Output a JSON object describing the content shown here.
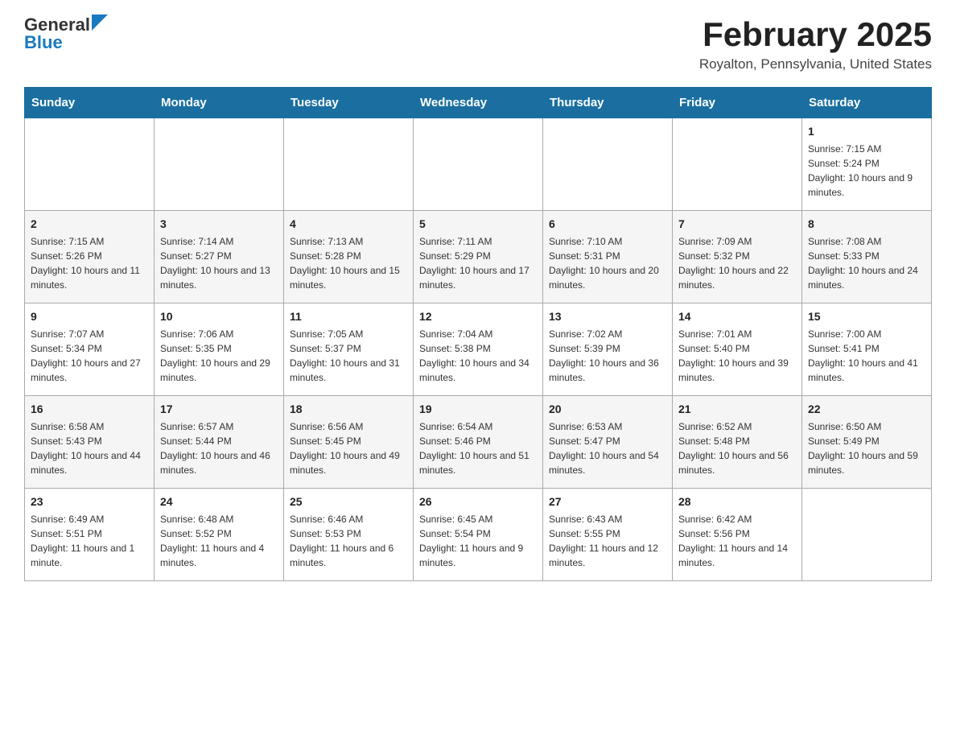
{
  "header": {
    "logo_general": "General",
    "logo_blue": "Blue",
    "month_title": "February 2025",
    "location": "Royalton, Pennsylvania, United States"
  },
  "days_of_week": [
    "Sunday",
    "Monday",
    "Tuesday",
    "Wednesday",
    "Thursday",
    "Friday",
    "Saturday"
  ],
  "weeks": [
    {
      "days": [
        {
          "num": "",
          "info": ""
        },
        {
          "num": "",
          "info": ""
        },
        {
          "num": "",
          "info": ""
        },
        {
          "num": "",
          "info": ""
        },
        {
          "num": "",
          "info": ""
        },
        {
          "num": "",
          "info": ""
        },
        {
          "num": "1",
          "info": "Sunrise: 7:15 AM\nSunset: 5:24 PM\nDaylight: 10 hours and 9 minutes."
        }
      ]
    },
    {
      "days": [
        {
          "num": "2",
          "info": "Sunrise: 7:15 AM\nSunset: 5:26 PM\nDaylight: 10 hours and 11 minutes."
        },
        {
          "num": "3",
          "info": "Sunrise: 7:14 AM\nSunset: 5:27 PM\nDaylight: 10 hours and 13 minutes."
        },
        {
          "num": "4",
          "info": "Sunrise: 7:13 AM\nSunset: 5:28 PM\nDaylight: 10 hours and 15 minutes."
        },
        {
          "num": "5",
          "info": "Sunrise: 7:11 AM\nSunset: 5:29 PM\nDaylight: 10 hours and 17 minutes."
        },
        {
          "num": "6",
          "info": "Sunrise: 7:10 AM\nSunset: 5:31 PM\nDaylight: 10 hours and 20 minutes."
        },
        {
          "num": "7",
          "info": "Sunrise: 7:09 AM\nSunset: 5:32 PM\nDaylight: 10 hours and 22 minutes."
        },
        {
          "num": "8",
          "info": "Sunrise: 7:08 AM\nSunset: 5:33 PM\nDaylight: 10 hours and 24 minutes."
        }
      ]
    },
    {
      "days": [
        {
          "num": "9",
          "info": "Sunrise: 7:07 AM\nSunset: 5:34 PM\nDaylight: 10 hours and 27 minutes."
        },
        {
          "num": "10",
          "info": "Sunrise: 7:06 AM\nSunset: 5:35 PM\nDaylight: 10 hours and 29 minutes."
        },
        {
          "num": "11",
          "info": "Sunrise: 7:05 AM\nSunset: 5:37 PM\nDaylight: 10 hours and 31 minutes."
        },
        {
          "num": "12",
          "info": "Sunrise: 7:04 AM\nSunset: 5:38 PM\nDaylight: 10 hours and 34 minutes."
        },
        {
          "num": "13",
          "info": "Sunrise: 7:02 AM\nSunset: 5:39 PM\nDaylight: 10 hours and 36 minutes."
        },
        {
          "num": "14",
          "info": "Sunrise: 7:01 AM\nSunset: 5:40 PM\nDaylight: 10 hours and 39 minutes."
        },
        {
          "num": "15",
          "info": "Sunrise: 7:00 AM\nSunset: 5:41 PM\nDaylight: 10 hours and 41 minutes."
        }
      ]
    },
    {
      "days": [
        {
          "num": "16",
          "info": "Sunrise: 6:58 AM\nSunset: 5:43 PM\nDaylight: 10 hours and 44 minutes."
        },
        {
          "num": "17",
          "info": "Sunrise: 6:57 AM\nSunset: 5:44 PM\nDaylight: 10 hours and 46 minutes."
        },
        {
          "num": "18",
          "info": "Sunrise: 6:56 AM\nSunset: 5:45 PM\nDaylight: 10 hours and 49 minutes."
        },
        {
          "num": "19",
          "info": "Sunrise: 6:54 AM\nSunset: 5:46 PM\nDaylight: 10 hours and 51 minutes."
        },
        {
          "num": "20",
          "info": "Sunrise: 6:53 AM\nSunset: 5:47 PM\nDaylight: 10 hours and 54 minutes."
        },
        {
          "num": "21",
          "info": "Sunrise: 6:52 AM\nSunset: 5:48 PM\nDaylight: 10 hours and 56 minutes."
        },
        {
          "num": "22",
          "info": "Sunrise: 6:50 AM\nSunset: 5:49 PM\nDaylight: 10 hours and 59 minutes."
        }
      ]
    },
    {
      "days": [
        {
          "num": "23",
          "info": "Sunrise: 6:49 AM\nSunset: 5:51 PM\nDaylight: 11 hours and 1 minute."
        },
        {
          "num": "24",
          "info": "Sunrise: 6:48 AM\nSunset: 5:52 PM\nDaylight: 11 hours and 4 minutes."
        },
        {
          "num": "25",
          "info": "Sunrise: 6:46 AM\nSunset: 5:53 PM\nDaylight: 11 hours and 6 minutes."
        },
        {
          "num": "26",
          "info": "Sunrise: 6:45 AM\nSunset: 5:54 PM\nDaylight: 11 hours and 9 minutes."
        },
        {
          "num": "27",
          "info": "Sunrise: 6:43 AM\nSunset: 5:55 PM\nDaylight: 11 hours and 12 minutes."
        },
        {
          "num": "28",
          "info": "Sunrise: 6:42 AM\nSunset: 5:56 PM\nDaylight: 11 hours and 14 minutes."
        },
        {
          "num": "",
          "info": ""
        }
      ]
    }
  ]
}
